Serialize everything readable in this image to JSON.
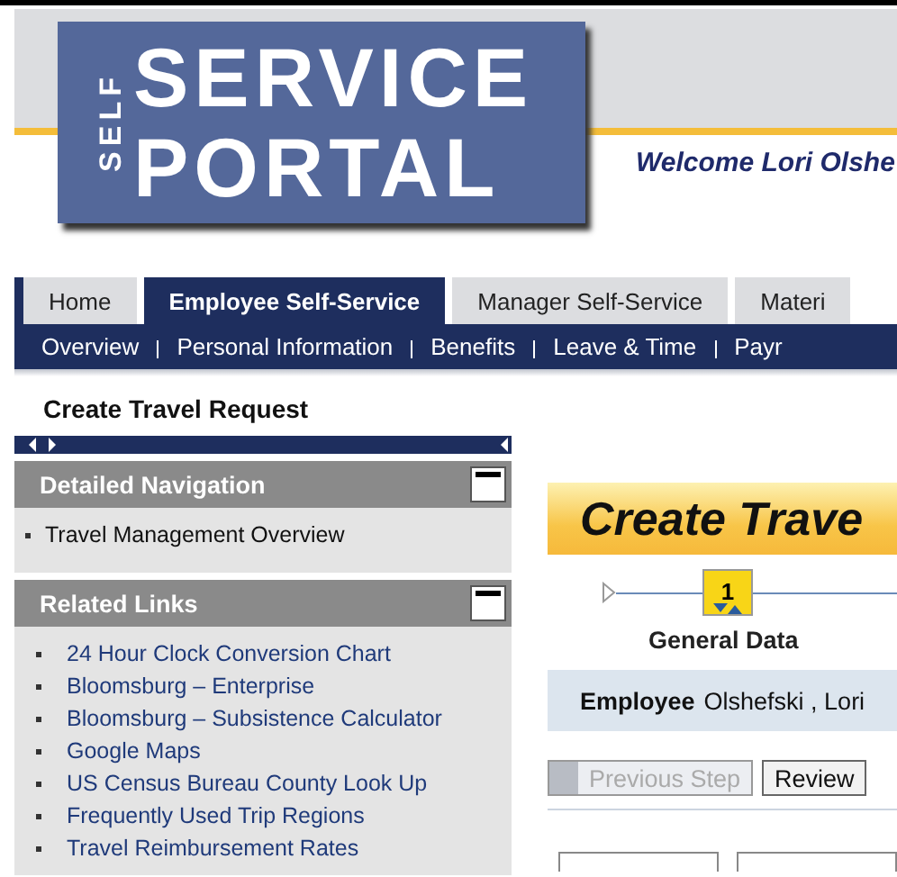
{
  "logo": {
    "vertical": "SELF",
    "line1": "SERVICE",
    "line2": "PORTAL"
  },
  "welcome": "Welcome Lori Olshe",
  "tabs": [
    {
      "label": "Home",
      "selected": false
    },
    {
      "label": "Employee Self-Service",
      "selected": true
    },
    {
      "label": "Manager Self-Service",
      "selected": false
    },
    {
      "label": "Materi",
      "selected": false
    }
  ],
  "subnav": [
    "Overview",
    "Personal Information",
    "Benefits",
    "Leave & Time",
    "Payr"
  ],
  "page_title": "Create Travel Request",
  "sidebar": {
    "sections": [
      {
        "title": "Detailed Navigation",
        "expanded": true,
        "items": [
          "Travel Management Overview"
        ]
      },
      {
        "title": "Related Links",
        "expanded": true,
        "items": [
          "24 Hour Clock Conversion Chart",
          "Bloomsburg – Enterprise",
          "Bloomsburg – Subsistence Calculator",
          "Google Maps",
          "US Census Bureau County Look Up",
          "Frequently Used Trip Regions",
          "Travel Reimbursement Rates"
        ]
      }
    ]
  },
  "content": {
    "title": "Create Trave",
    "steps": [
      {
        "number": "1",
        "label": "General Data",
        "selected": true
      }
    ],
    "employee_label": "Employee",
    "employee_value": "Olshefski , Lori",
    "buttons": [
      {
        "label": "Previous Step",
        "disabled": true
      },
      {
        "label": "Review",
        "disabled": false
      }
    ]
  }
}
